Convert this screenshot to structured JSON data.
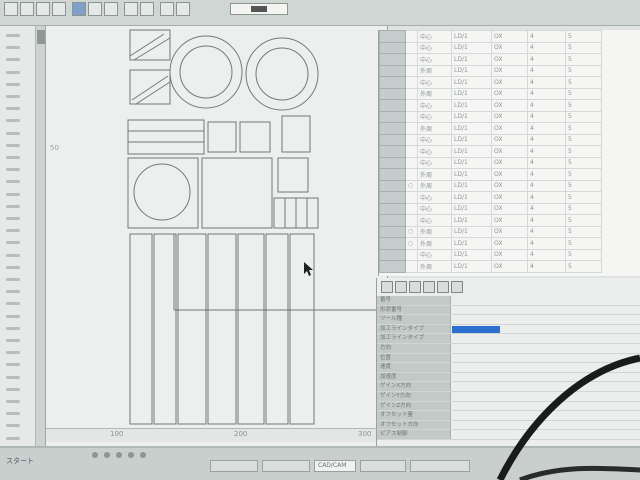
{
  "toolbar": {
    "buttons": [
      {
        "icon": "file-icon"
      },
      {
        "icon": "open-icon"
      },
      {
        "icon": "save-icon"
      },
      {
        "icon": "print-icon"
      },
      {
        "icon": "cut-icon"
      },
      {
        "icon": "copy-icon"
      },
      {
        "icon": "paste-icon"
      },
      {
        "icon": "undo-icon"
      },
      {
        "icon": "redo-icon"
      },
      {
        "icon": "zoom-icon"
      },
      {
        "icon": "grid-icon"
      }
    ]
  },
  "canvas": {
    "ruler_labels": [
      "100",
      "200",
      "300"
    ],
    "side_label": "50"
  },
  "grid": {
    "rows": [
      [
        "",
        "中心",
        "LD/1",
        "OX",
        "4",
        "5"
      ],
      [
        "",
        "中心",
        "LD/1",
        "OX",
        "4",
        "5"
      ],
      [
        "",
        "中心",
        "LD/1",
        "OX",
        "4",
        "5"
      ],
      [
        "",
        "外周",
        "LD/1",
        "OX",
        "4",
        "5"
      ],
      [
        "",
        "中心",
        "LD/1",
        "OX",
        "4",
        "5"
      ],
      [
        "",
        "外周",
        "LD/1",
        "OX",
        "4",
        "5"
      ],
      [
        "",
        "中心",
        "LD/1",
        "OX",
        "4",
        "5"
      ],
      [
        "",
        "中心",
        "LD/1",
        "OX",
        "4",
        "5"
      ],
      [
        "",
        "外周",
        "LD/1",
        "OX",
        "4",
        "5"
      ],
      [
        "",
        "中心",
        "LD/1",
        "OX",
        "4",
        "5"
      ],
      [
        "",
        "中心",
        "LD/1",
        "OX",
        "4",
        "5"
      ],
      [
        "",
        "中心",
        "LD/1",
        "OX",
        "4",
        "5"
      ],
      [
        "",
        "外周",
        "LD/1",
        "OX",
        "4",
        "5"
      ],
      [
        "○",
        "外周",
        "LD/1",
        "OX",
        "4",
        "5"
      ],
      [
        "",
        "中心",
        "LD/1",
        "OX",
        "4",
        "5"
      ],
      [
        "",
        "中心",
        "LD/1",
        "OX",
        "4",
        "5"
      ],
      [
        "",
        "中心",
        "LD/1",
        "OX",
        "4",
        "5"
      ],
      [
        "○",
        "外周",
        "LD/1",
        "OX",
        "4",
        "5"
      ],
      [
        "○",
        "外周",
        "LD/1",
        "OX",
        "4",
        "5"
      ],
      [
        "",
        "中心",
        "LD/1",
        "OX",
        "4",
        "5"
      ],
      [
        "",
        "外周",
        "LD/1",
        "OX",
        "4",
        "5"
      ]
    ]
  },
  "properties": {
    "rows": [
      {
        "key": "番号"
      },
      {
        "key": "形状番号"
      },
      {
        "key": "ツール種"
      },
      {
        "key": "加工ラインタイプ",
        "selected": true
      },
      {
        "key": "加工ラインタイプ"
      },
      {
        "key": "方向"
      },
      {
        "key": "位置"
      },
      {
        "key": "速度"
      },
      {
        "key": "加速度"
      },
      {
        "key": "ゲインX方向"
      },
      {
        "key": "ゲインY方向"
      },
      {
        "key": "ゲインZ方向"
      },
      {
        "key": "オフセット量"
      },
      {
        "key": "オフセット方向"
      },
      {
        "key": "ピアス制御"
      }
    ]
  },
  "taskbar": {
    "start_label": "スタート",
    "tasks": [
      {
        "label": ""
      },
      {
        "label": ""
      },
      {
        "label": "CAD/CAM"
      },
      {
        "label": ""
      },
      {
        "label": ""
      }
    ]
  }
}
